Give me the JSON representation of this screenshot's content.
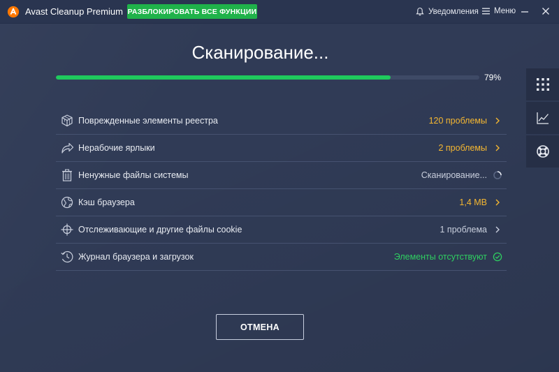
{
  "window": {
    "title": "Avast Cleanup Premium",
    "unlock_button": "РАЗБЛОКИРОВАТЬ ВСЕ ФУНКЦИИ",
    "notifications_label": "Уведомления",
    "menu_label": "Меню",
    "icons": [
      "avast-logo",
      "bell-icon",
      "hamburger-icon",
      "minimize-icon",
      "close-icon"
    ]
  },
  "scan": {
    "heading": "Сканирование...",
    "progress_percent": 79,
    "progress_text": "79%"
  },
  "results": [
    {
      "label": "Поврежденные элементы реестра",
      "status": "120 проблемы",
      "status_color": "#f5b731",
      "icon": "registry-cube-icon",
      "trail": "chevron-right-icon"
    },
    {
      "label": "Нерабочие ярлыки",
      "status": "2 проблемы",
      "status_color": "#f5b731",
      "icon": "shortcut-arrow-icon",
      "trail": "chevron-right-icon"
    },
    {
      "label": "Ненужные файлы системы",
      "status": "Сканирование...",
      "status_color": "#c9cfdd",
      "icon": "trash-icon",
      "trail": "spinner-icon"
    },
    {
      "label": "Кэш браузера",
      "status": "1,4 МВ",
      "status_color": "#f5b731",
      "icon": "globe-icon",
      "trail": "chevron-right-icon"
    },
    {
      "label": "Отслеживающие и другие файлы cookie",
      "status": "1 проблема",
      "status_color": "#c9cfdd",
      "icon": "crosshair-icon",
      "trail": "chevron-right-icon"
    },
    {
      "label": "Журнал браузера и загрузок",
      "status": "Элементы отсутствуют",
      "status_color": "#2ecf61",
      "icon": "history-clock-icon",
      "trail": "check-circle-icon"
    }
  ],
  "side_panel": [
    "grid-icon",
    "chart-icon",
    "lifebuoy-icon"
  ],
  "cancel_button": "ОТМЕНА",
  "colors": {
    "background": "#303b56",
    "accent_green": "#1fb24a",
    "progress_green": "#1fca5d",
    "warning_orange": "#f5b731",
    "ok_green": "#2ecf61"
  }
}
